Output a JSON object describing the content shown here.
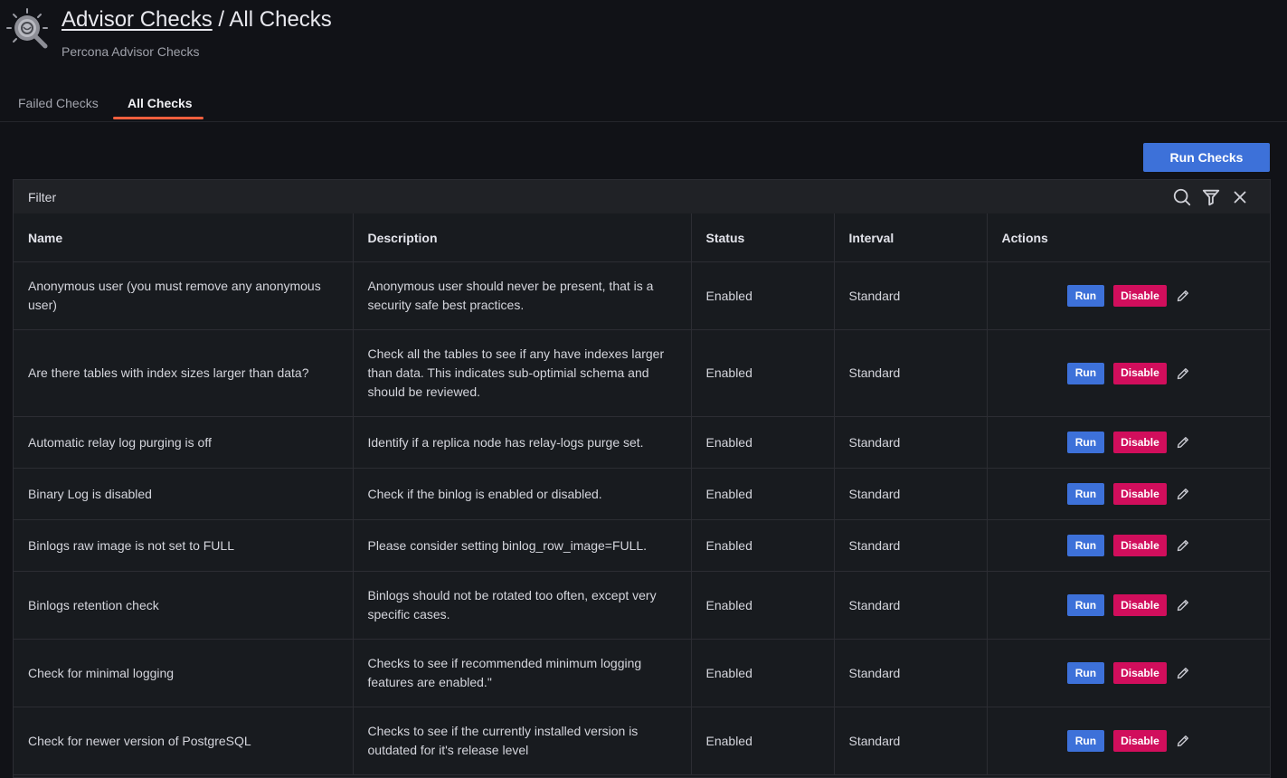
{
  "header": {
    "title_link": "Advisor Checks",
    "title_separator": " / ",
    "title_current": "All Checks",
    "subtitle": "Percona Advisor Checks"
  },
  "tabs": [
    {
      "label": "Failed Checks",
      "active": false
    },
    {
      "label": "All Checks",
      "active": true
    }
  ],
  "toolbar": {
    "run_checks_label": "Run Checks"
  },
  "filter": {
    "label": "Filter",
    "icons": [
      "search-icon",
      "filter-icon",
      "close-icon"
    ]
  },
  "table": {
    "columns": [
      "Name",
      "Description",
      "Status",
      "Interval",
      "Actions"
    ],
    "run_label": "Run",
    "disable_label": "Disable",
    "rows": [
      {
        "name": "Anonymous user (you must remove any anonymous user)",
        "description": "Anonymous user should never be present, that is a security safe best practices.",
        "status": "Enabled",
        "interval": "Standard"
      },
      {
        "name": "Are there tables with index sizes larger than data?",
        "description": "Check all the tables to see if any have indexes larger than data. This indicates sub-optimial schema and should be reviewed.",
        "status": "Enabled",
        "interval": "Standard"
      },
      {
        "name": "Automatic relay log purging is off",
        "description": "Identify if a replica node has relay-logs purge set.",
        "status": "Enabled",
        "interval": "Standard"
      },
      {
        "name": "Binary Log is disabled",
        "description": "Check if the binlog is enabled or disabled.",
        "status": "Enabled",
        "interval": "Standard"
      },
      {
        "name": "Binlogs raw image is not set to FULL",
        "description": "Please consider setting binlog_row_image=FULL.",
        "status": "Enabled",
        "interval": "Standard"
      },
      {
        "name": "Binlogs retention check",
        "description": "Binlogs should not be rotated too often, except very specific cases.",
        "status": "Enabled",
        "interval": "Standard"
      },
      {
        "name": "Check for minimal logging",
        "description": "Checks to see if recommended minimum logging features are enabled.\"",
        "status": "Enabled",
        "interval": "Standard"
      },
      {
        "name": "Check for newer version of PostgreSQL",
        "description": "Checks to see if the currently installed version is outdated for it's release level",
        "status": "Enabled",
        "interval": "Standard"
      }
    ]
  },
  "colors": {
    "background": "#111217",
    "panel": "#181b1f",
    "accent_tab": "#f55f3e",
    "primary_button": "#3d71d9",
    "destructive_button": "#d10e5c"
  }
}
